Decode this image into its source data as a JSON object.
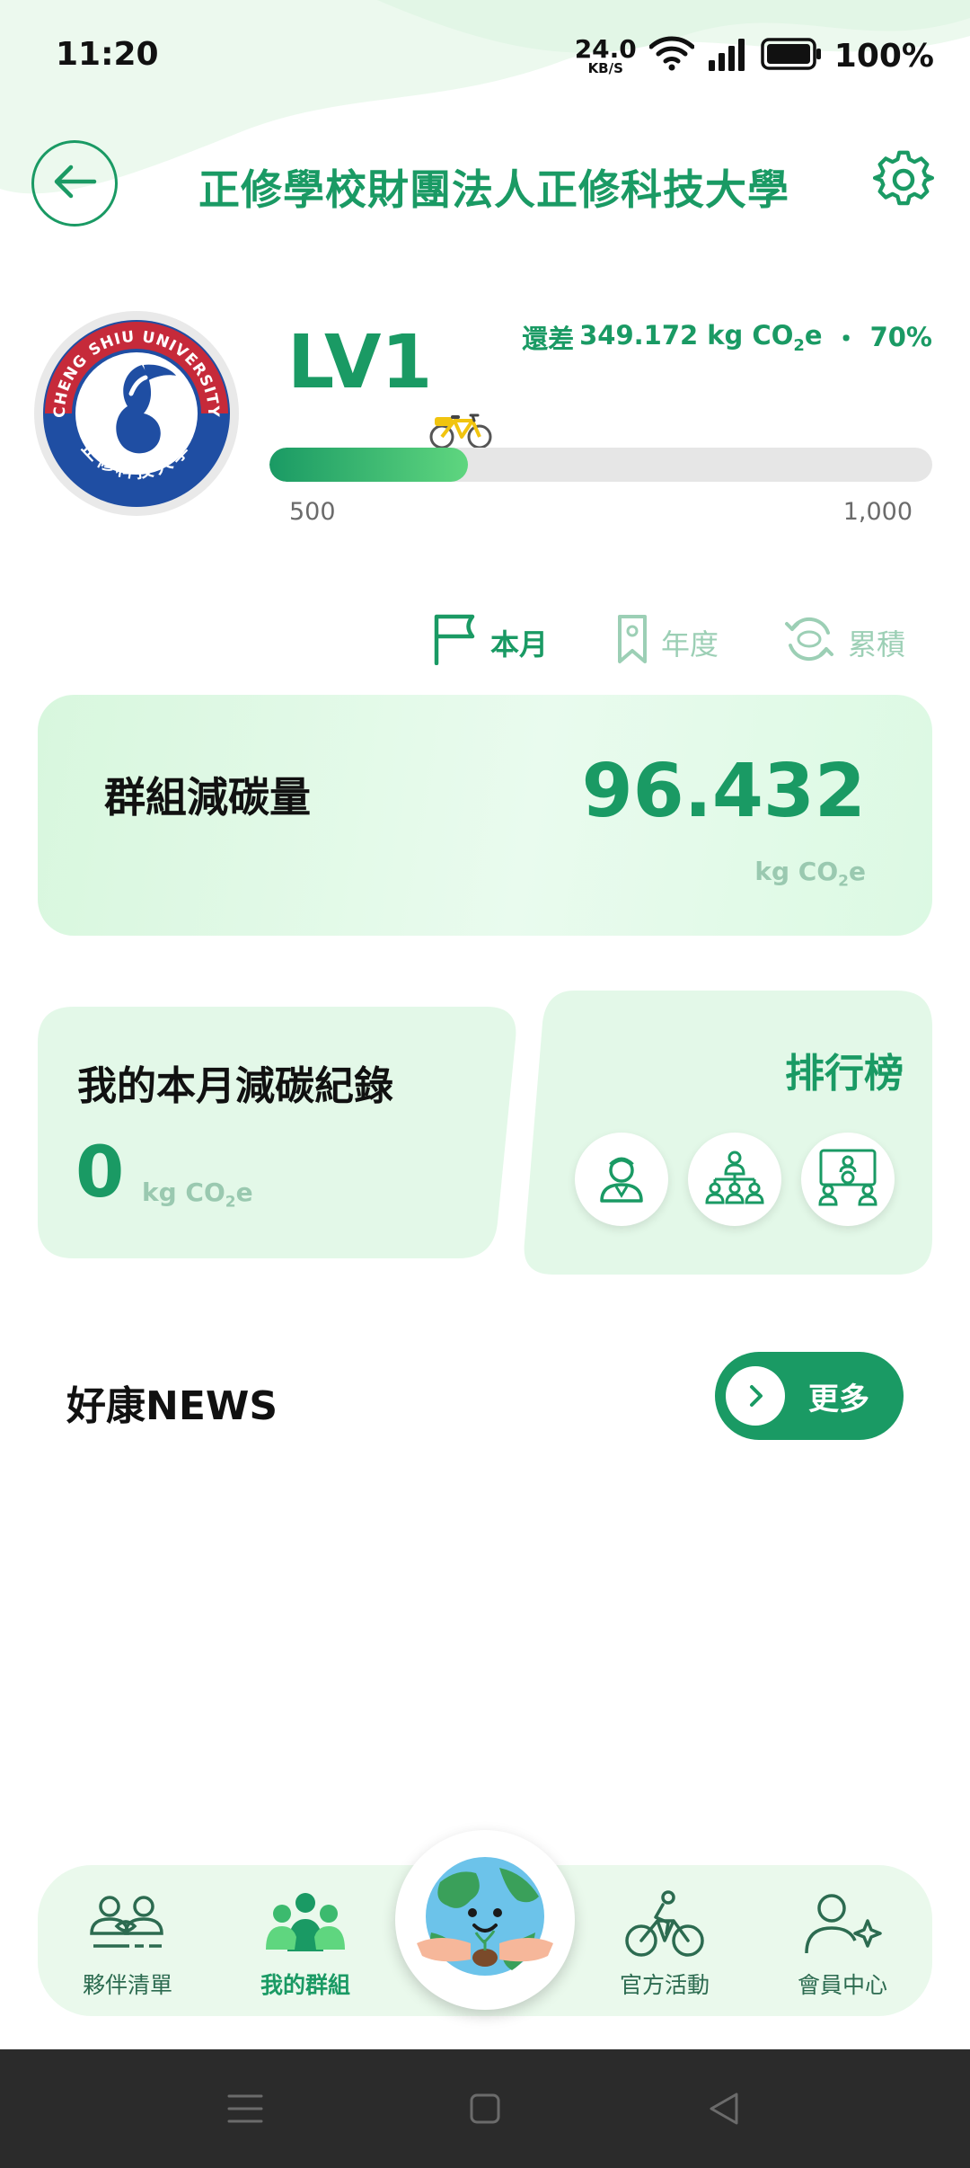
{
  "status_bar": {
    "time": "11:20",
    "net_speed_value": "24.0",
    "net_speed_unit": "KB/S",
    "battery": "100%",
    "icons": [
      "wifi-icon",
      "signal-icon",
      "battery-icon"
    ]
  },
  "header": {
    "title": "正修學校財團法人正修科技大學",
    "back_icon": "arrow-left-icon",
    "settings_icon": "gear-icon"
  },
  "profile": {
    "logo_text_top": "CHENG SHIU UNIVERSITY",
    "logo_text_bottom": "正修科技大學",
    "level": "LV1",
    "remaining_prefix": "還差",
    "remaining_value": "349.172 kg CO",
    "remaining_sub": "2",
    "remaining_suffix": "e",
    "separator": "・",
    "percent": "70%",
    "progress_fraction": 0.3,
    "progress_min": "500",
    "progress_max": "1,000"
  },
  "period_tabs": [
    {
      "label": "本月",
      "icon": "flag-icon",
      "active": true
    },
    {
      "label": "年度",
      "icon": "bookmark-icon",
      "active": false
    },
    {
      "label": "累積",
      "icon": "cycle-icon",
      "active": false
    }
  ],
  "group_reduction": {
    "label": "群組減碳量",
    "value": "96.432",
    "unit_prefix": "kg CO",
    "unit_sub": "2",
    "unit_suffix": "e"
  },
  "monthly_record": {
    "label": "我的本月減碳紀錄",
    "value": "0",
    "unit_prefix": "kg CO",
    "unit_sub": "2",
    "unit_suffix": "e"
  },
  "ranking": {
    "label": "排行榜",
    "icons": [
      "person-icon",
      "group-icon",
      "department-icon"
    ]
  },
  "news": {
    "title": "好康NEWS",
    "more_label": "更多"
  },
  "bottom_nav": {
    "items": [
      {
        "label": "夥伴清單",
        "icon": "partners-icon",
        "active": false
      },
      {
        "label": "我的群組",
        "icon": "group-icon",
        "active": true
      },
      {
        "label": "官方活動",
        "icon": "cyclist-icon",
        "active": false
      },
      {
        "label": "會員中心",
        "icon": "member-icon",
        "active": false
      }
    ],
    "center_icon": "earth-mascot-icon"
  },
  "system_nav": {
    "icons": [
      "menu-icon",
      "home-icon",
      "back-icon"
    ]
  },
  "colors": {
    "brand_green": "#1a9a64",
    "light_green": "#e3f8e8",
    "muted_unit": "#9ac9b0"
  }
}
